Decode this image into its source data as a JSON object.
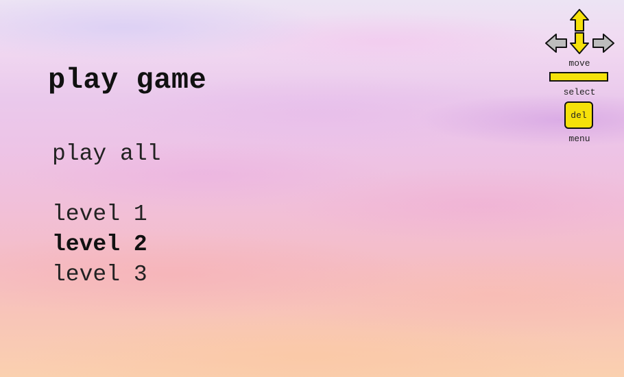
{
  "title": "play game",
  "menu": {
    "items": [
      {
        "label": "play all"
      },
      {
        "label": "level 1"
      },
      {
        "label": "level 2",
        "selected": true
      },
      {
        "label": "level 3"
      }
    ]
  },
  "controls": {
    "move_label": "move",
    "select_label": "select",
    "del_key_label": "del",
    "menu_label": "menu",
    "move_icon": "arrow-keys-icon",
    "select_icon": "spacebar-icon",
    "menu_icon": "del-key-icon"
  },
  "colors": {
    "key_fill": "#f5e10a",
    "inactive_arrow": "#bdbdbd",
    "text": "#111111"
  }
}
